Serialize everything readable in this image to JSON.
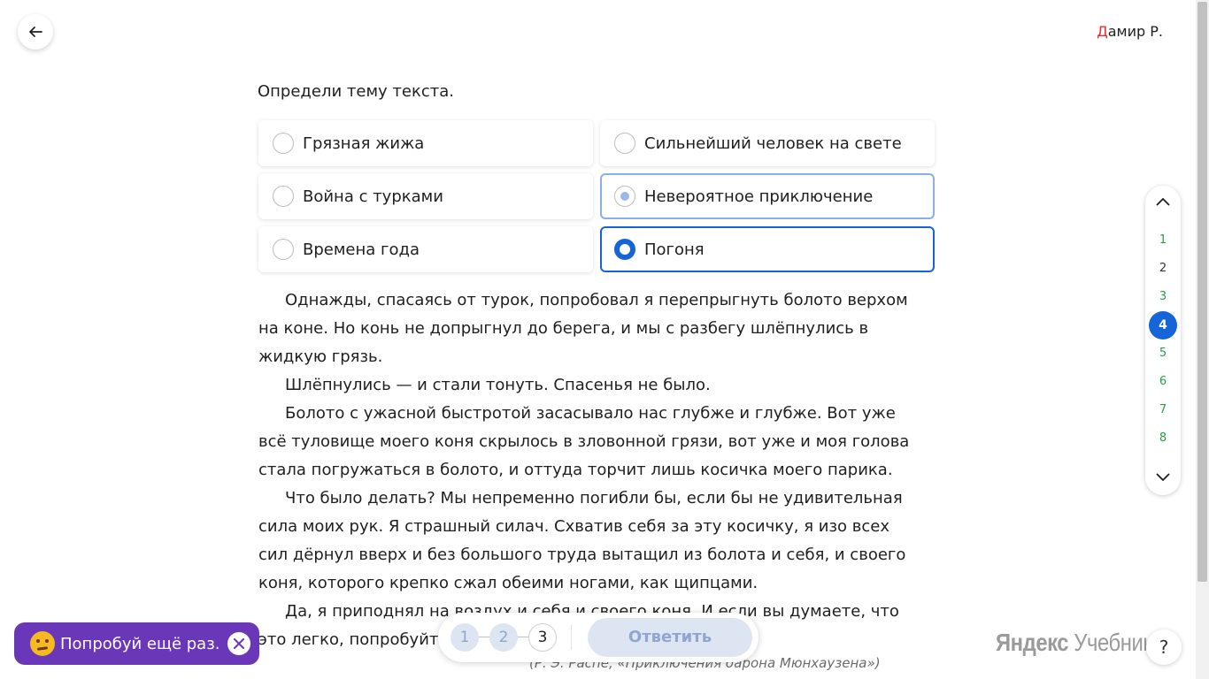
{
  "header": {
    "user_initial": "Д",
    "user_rest": "амир Р."
  },
  "question": "Определи тему текста.",
  "options": [
    {
      "label": "Грязная жижа",
      "state": "default"
    },
    {
      "label": "Сильнейший человек на свете",
      "state": "default"
    },
    {
      "label": "Война с турками",
      "state": "default"
    },
    {
      "label": "Невероятное приключение",
      "state": "hover"
    },
    {
      "label": "Времена года",
      "state": "default"
    },
    {
      "label": "Погоня",
      "state": "selected"
    }
  ],
  "passage": {
    "paragraphs": [
      "Однажды, спасаясь от турок, попробовал я перепрыгнуть болото верхом на коне. Но конь не допрыгнул до берега, и мы с разбегу шлёпнулись в жидкую грязь.",
      "Шлёпнулись — и стали тонуть. Спасенья не было.",
      "Болото с ужасной быстротой засасывало нас глубже и глубже. Вот уже всё туловище моего коня скрылось в зловонной грязи, вот уже и моя голова стала погружаться в болото, и оттуда торчит лишь косичка моего парика.",
      "Что было делать? Мы непременно погибли бы, если бы не удивительная сила моих рук. Я страшный силач. Схватив себя за эту косичку, я изо всех сил дёрнул вверх и без большого труда вытащил из болота и себя, и своего коня, которого крепко сжал обеими ногами, как щипцами.",
      "Да, я приподнял на воздух и себя и своего коня. И если вы думаете, что это легко, попробуйте проделать это сами."
    ],
    "attribution": "(Р. Э. Распе, «Приключения барона Мюнхаузена»)"
  },
  "task_nav": {
    "numbers": [
      "1",
      "2",
      "3",
      "4",
      "5",
      "6",
      "7",
      "8"
    ],
    "current": "4"
  },
  "toast": {
    "text": "Попробуй ещё раз."
  },
  "bottom_bar": {
    "steps": [
      "1",
      "2",
      "3"
    ],
    "active_step": "3",
    "answer_label": "Ответить"
  },
  "brand": {
    "bold": "Яндекс",
    "light": " Учебник"
  },
  "help_label": "?",
  "colors": {
    "accent": "#1565d8",
    "done": "#1fa14a",
    "toast": "#6a37b8",
    "brand_red": "#e62e2e"
  }
}
